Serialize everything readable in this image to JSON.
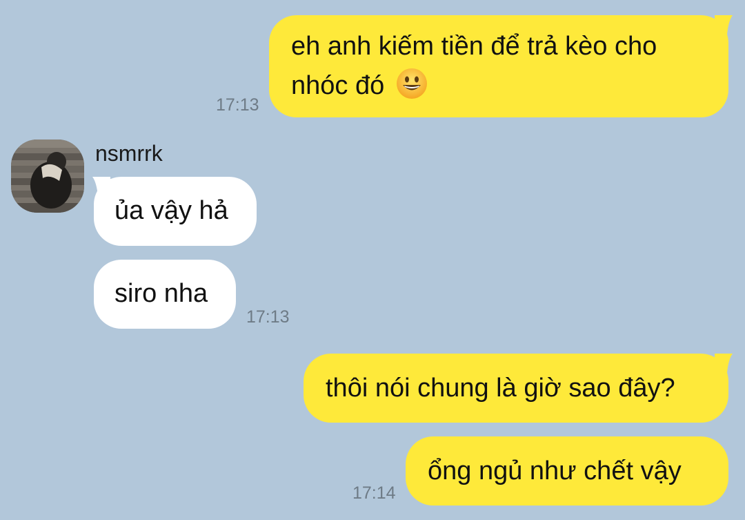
{
  "contact": {
    "name": "nsmrrk"
  },
  "messages": [
    {
      "from": "me",
      "text": "eh anh kiếm tiền để trả kèo cho nhóc đó",
      "emoji": "grinning-face-emoji",
      "time": "17:13"
    },
    {
      "from": "them",
      "text": "ủa vậy hả"
    },
    {
      "from": "them",
      "text": "siro nha",
      "time": "17:13"
    },
    {
      "from": "me",
      "text": "thôi nói chung là giờ sao đây?"
    },
    {
      "from": "me",
      "text": "ổng ngủ như chết vậy",
      "time": "17:14"
    }
  ],
  "colors": {
    "background": "#b2c7da",
    "my_bubble": "#fee93a",
    "their_bubble": "#ffffff",
    "timestamp": "#6e7b86"
  }
}
